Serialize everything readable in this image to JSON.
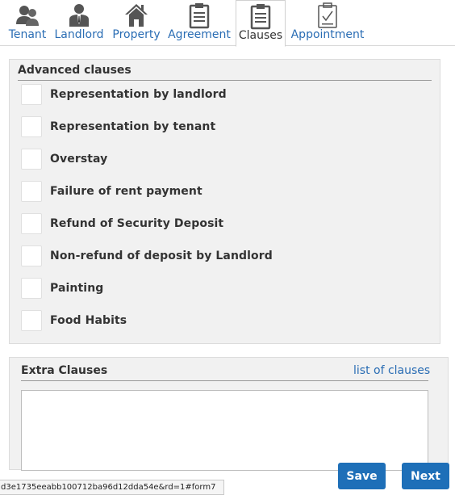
{
  "tabs": [
    {
      "label": "Tenant",
      "icon": "tenant-icon",
      "active": false
    },
    {
      "label": "Landlord",
      "icon": "landlord-icon",
      "active": false
    },
    {
      "label": "Property",
      "icon": "house-icon",
      "active": false
    },
    {
      "label": "Agreement",
      "icon": "clipboard-icon",
      "active": false
    },
    {
      "label": "Clauses",
      "icon": "clipboard-icon",
      "active": true
    },
    {
      "label": "Appointment",
      "icon": "clipboard-check-icon",
      "active": false
    }
  ],
  "advanced": {
    "title": "Advanced clauses",
    "clauses": [
      {
        "label": "Representation by landlord",
        "checked": false
      },
      {
        "label": "Representation by tenant",
        "checked": false
      },
      {
        "label": "Overstay",
        "checked": false
      },
      {
        "label": "Failure of rent payment",
        "checked": false
      },
      {
        "label": "Refund of Security Deposit",
        "checked": false
      },
      {
        "label": "Non-refund of deposit by Landlord",
        "checked": false
      },
      {
        "label": "Painting",
        "checked": false
      },
      {
        "label": "Food Habits",
        "checked": false
      }
    ]
  },
  "extra": {
    "title": "Extra Clauses",
    "link_label": "list of clauses",
    "value": ""
  },
  "footer": {
    "save_label": "Save",
    "next_label": "Next"
  },
  "status_url": "d3e1735eeabb100712ba96d12dda54e&rd=1#form7",
  "colors": {
    "accent": "#2a6db4",
    "button": "#1e6fb8",
    "panel": "#f1f1f1"
  }
}
